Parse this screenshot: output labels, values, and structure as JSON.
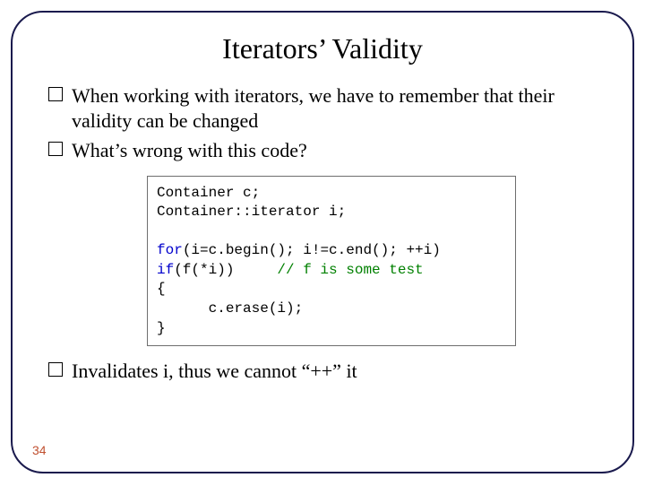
{
  "title": "Iterators’ Validity",
  "bullets": {
    "b1": "When working with iterators, we have to remember that their validity can  be changed",
    "b2": "What’s wrong with this code?",
    "b3": "Invalidates i, thus we cannot “++” it"
  },
  "code": {
    "l1": "Container c;",
    "l2": "Container::iterator i;",
    "blank1": "",
    "l3a": "for",
    "l3b": "(i=c.begin(); i!=c.end(); ++i)",
    "l4a": "if",
    "l4b": "(f(*i))     ",
    "l4c": "// f is some test",
    "l5": "{",
    "l6": "      c.erase(i);",
    "l7": "}"
  },
  "page": "34"
}
